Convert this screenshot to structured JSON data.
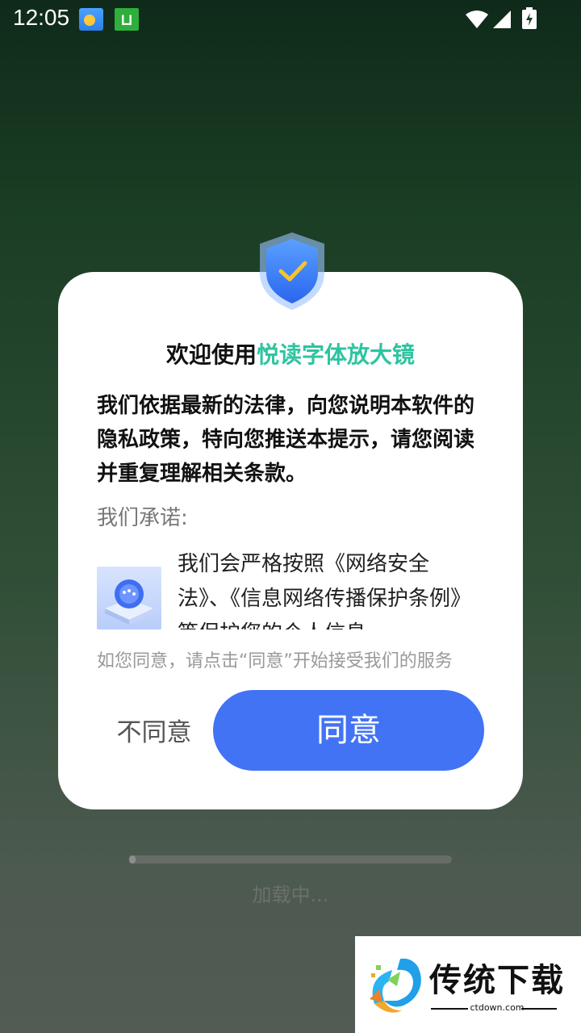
{
  "status_bar": {
    "time": "12:05",
    "icons": [
      "weather-icon",
      "app-notification-icon",
      "wifi-icon",
      "signal-icon",
      "battery-charging-icon"
    ]
  },
  "dialog": {
    "title_prefix": "欢迎使用",
    "app_name": "悦读字体放大镜",
    "app_name_color": "#2ec4a0",
    "intro": "我们依据最新的法律，向您说明本软件的隐私政策，特向您推送本提示，请您阅读并重复理解相关条款。",
    "promise_label": "我们承诺:",
    "promise_text": "我们会严格按照《网络安全法》、《信息网络传播保护条例》等保护您的个人信息",
    "agree_hint": "如您同意，请点击“同意”开始接受我们的服务",
    "disagree_label": "不同意",
    "agree_label": "同意",
    "agree_color": "#4273f5"
  },
  "loading": {
    "text": "加载中...",
    "progress_percent": 2
  },
  "watermark": {
    "name": "传统下载",
    "url": "ctdown.com"
  }
}
